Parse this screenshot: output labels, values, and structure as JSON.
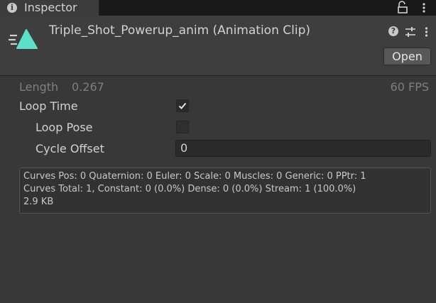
{
  "tab": {
    "title": "Inspector",
    "icon": "info-icon"
  },
  "header": {
    "title": "Triple_Shot_Powerup_anim (Animation Clip)",
    "icon": "animation-clip-icon",
    "open_label": "Open",
    "accent_color": "#5ce0c8"
  },
  "properties": {
    "length_label": "Length",
    "length_value": "0.267",
    "fps": "60 FPS",
    "loop_time_label": "Loop Time",
    "loop_time_checked": true,
    "loop_pose_label": "Loop Pose",
    "loop_pose_checked": false,
    "cycle_offset_label": "Cycle Offset",
    "cycle_offset_value": "0"
  },
  "info": {
    "line1": "Curves Pos: 0 Quaternion: 0 Euler: 0 Scale: 0 Muscles: 0 Generic: 0 PPtr: 1",
    "line2": "Curves Total: 1, Constant: 0 (0.0%) Dense: 0 (0.0%) Stream: 1 (100.0%)",
    "line3": "2.9 KB"
  }
}
